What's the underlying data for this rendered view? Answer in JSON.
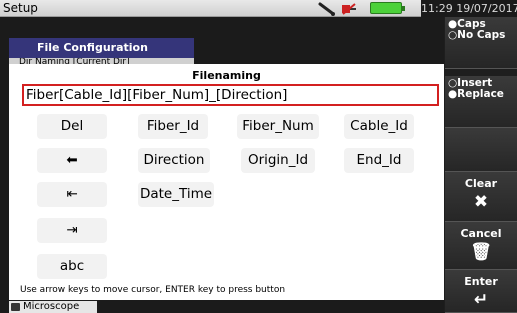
{
  "app": {
    "title": "Setup",
    "clock": "11:29 19/07/2017"
  },
  "file_config": {
    "tab_label": "File Configuration",
    "sub_label": "Dir Naming          [Current Dir]"
  },
  "filenaming": {
    "label": "Filenaming",
    "value": "Fiber[Cable_Id][Fiber_Num]_[Direction]"
  },
  "keys": {
    "del": "Del",
    "fiber_id": "Fiber_Id",
    "fiber_num": "Fiber_Num",
    "cable_id": "Cable_Id",
    "backspace": "⬅",
    "direction": "Direction",
    "origin_id": "Origin_Id",
    "end_id": "End_Id",
    "home": "⇤",
    "date_time": "Date_Time",
    "end": "⇥",
    "abc": "abc"
  },
  "hint": "Use arrow keys to move cursor, ENTER key to press button",
  "bottom": {
    "microscope": "Microscope"
  },
  "side": {
    "caps": "●Caps",
    "no_caps": "○No Caps",
    "insert": "○Insert",
    "replace": "●Replace",
    "clear": "Clear",
    "clear_icon": "✖",
    "cancel": "Cancel",
    "cancel_icon": "🗑",
    "enter": "Enter",
    "enter_icon": "↵"
  },
  "colors": {
    "accent": "#35357a",
    "input_border": "#d32020",
    "battery": "#4cd13a"
  }
}
